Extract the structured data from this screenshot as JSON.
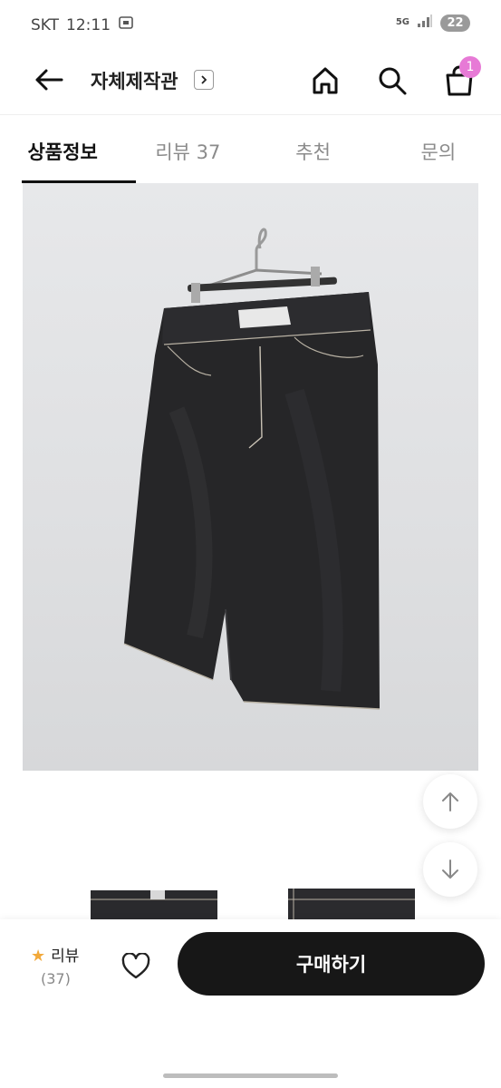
{
  "status_bar": {
    "carrier": "SKT",
    "time": "12:11",
    "network": "5G",
    "battery": "22"
  },
  "header": {
    "store_name": "자체제작관",
    "icons": [
      "back-arrow-icon",
      "chevron-right-icon",
      "home-icon",
      "search-icon",
      "shopping-bag-icon"
    ],
    "cart_badge": "1"
  },
  "tabs": [
    {
      "label": "상품정보",
      "active": true
    },
    {
      "label": "리뷰 37",
      "active": false
    },
    {
      "label": "추천",
      "active": false
    },
    {
      "label": "문의",
      "active": false
    }
  ],
  "product": {
    "image": "black-denim-bermuda-shorts-on-hanger"
  },
  "floating": {
    "icons": [
      "arrow-up-icon",
      "arrow-down-icon"
    ]
  },
  "bottom_bar": {
    "review_label": "리뷰",
    "review_count": "(37)",
    "buy_label": "구매하기",
    "icons": [
      "star-icon",
      "heart-icon"
    ]
  },
  "colors": {
    "accent_badge": "#e77ad6",
    "star": "#f2a93b",
    "buy_button": "#171717"
  }
}
